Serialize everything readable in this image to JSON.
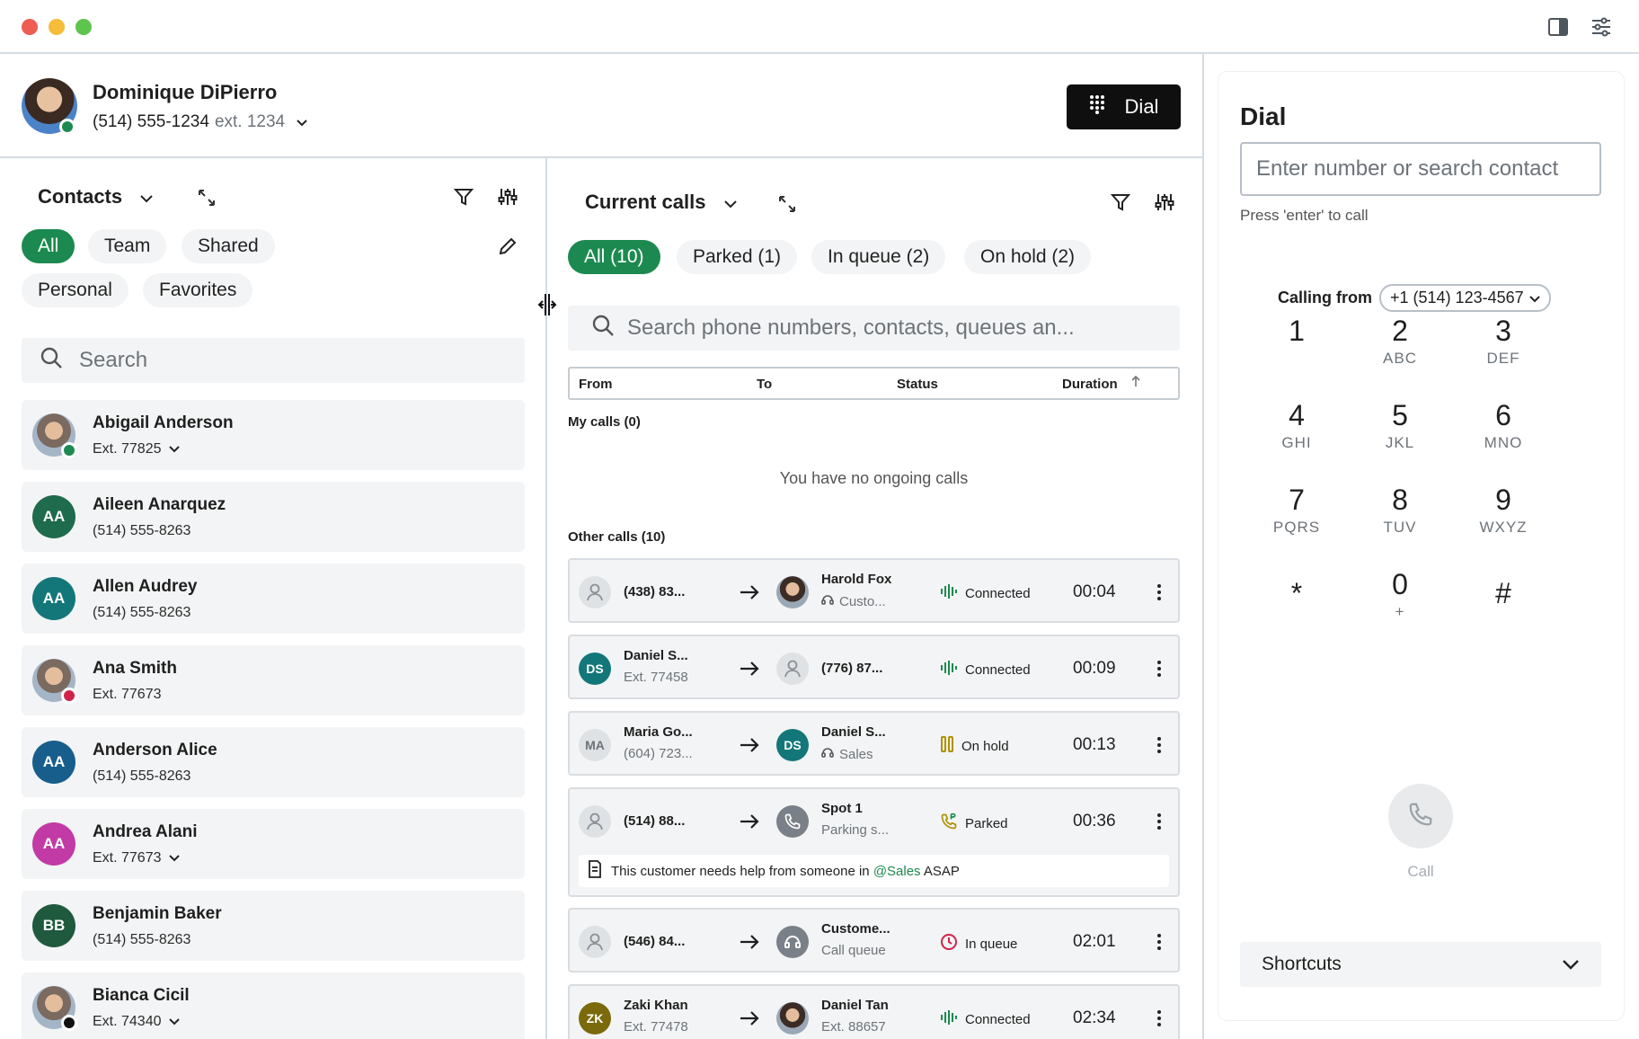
{
  "user": {
    "name": "Dominique DiPierro",
    "phone": "(514) 555-1234",
    "ext": "ext. 1234",
    "presence_color": "#1c8a50"
  },
  "dial_button": "Dial",
  "contacts": {
    "title": "Contacts",
    "filters": [
      "All",
      "Team",
      "Shared",
      "Personal",
      "Favorites"
    ],
    "search_placeholder": "Search",
    "items": [
      {
        "name": "Abigail Anderson",
        "sub": "Ext. 77825",
        "initials": "",
        "color": "",
        "presence": "available",
        "has_chevron": true
      },
      {
        "name": "Aileen Anarquez",
        "sub": "(514) 555-8263",
        "initials": "AA",
        "color": "#1f6b4d",
        "presence": "",
        "has_chevron": false
      },
      {
        "name": "Allen Audrey",
        "sub": "(514) 555-8263",
        "initials": "AA",
        "color": "#13777a",
        "presence": "",
        "has_chevron": false
      },
      {
        "name": "Ana Smith",
        "sub": "Ext. 77673",
        "initials": "",
        "color": "",
        "presence": "busy",
        "has_chevron": false
      },
      {
        "name": "Anderson Alice",
        "sub": "(514) 555-8263",
        "initials": "AA",
        "color": "#175e8c",
        "presence": "",
        "has_chevron": false
      },
      {
        "name": "Andrea Alani",
        "sub": "Ext. 77673",
        "initials": "AA",
        "color": "#c13aa6",
        "presence": "",
        "has_chevron": true
      },
      {
        "name": "Benjamin Baker",
        "sub": "(514) 555-8263",
        "initials": "BB",
        "color": "#1f5a3f",
        "presence": "",
        "has_chevron": false
      },
      {
        "name": "Bianca Cicil",
        "sub": "Ext. 74340",
        "initials": "",
        "color": "",
        "presence": "dnd",
        "has_chevron": true
      }
    ]
  },
  "calls": {
    "title": "Current calls",
    "filters": [
      "All (10)",
      "Parked (1)",
      "In queue (2)",
      "On hold (2)"
    ],
    "search_placeholder": "Search phone numbers, contacts, queues an...",
    "columns": [
      "From",
      "To",
      "Status",
      "Duration"
    ],
    "my_calls_label": "My calls (0)",
    "empty_message": "You have no ongoing calls",
    "other_calls_label": "Other calls (10)",
    "items": [
      {
        "from": "(438) 83...",
        "from_sub": "",
        "from_initials": "",
        "from_color": "",
        "to": "Harold Fox",
        "to_sub": "Custo...",
        "to_type": "photo",
        "to_initials": "",
        "to_color": "",
        "status": "Connected",
        "status_type": "connected",
        "duration": "00:04"
      },
      {
        "from": "Daniel S...",
        "from_sub": "Ext. 77458",
        "from_initials": "DS",
        "from_color": "#13777a",
        "to": "(776) 87...",
        "to_sub": "",
        "to_type": "generic",
        "to_initials": "",
        "to_color": "",
        "status": "Connected",
        "status_type": "connected",
        "duration": "00:09"
      },
      {
        "from": "Maria Go...",
        "from_sub": "(604) 723...",
        "from_initials": "MA",
        "from_color": "#dfe2e5",
        "to": "Daniel S...",
        "to_sub": "Sales",
        "to_type": "initials",
        "to_initials": "DS",
        "to_color": "#13777a",
        "status": "On hold",
        "status_type": "hold",
        "duration": "00:13"
      },
      {
        "from": "(514) 88...",
        "from_sub": "",
        "from_initials": "",
        "from_color": "",
        "to": "Spot 1",
        "to_sub": "Parking s...",
        "to_type": "parking",
        "to_initials": "",
        "to_color": "",
        "status": "Parked",
        "status_type": "parked",
        "duration": "00:36",
        "note_prefix": "This customer needs help from someone in",
        "note_mention": "@Sales",
        "note_suffix": "ASAP"
      },
      {
        "from": "(546) 84...",
        "from_sub": "",
        "from_initials": "",
        "from_color": "",
        "to": "Custome...",
        "to_sub": "Call queue",
        "to_type": "queue",
        "to_initials": "",
        "to_color": "",
        "status": "In queue",
        "status_type": "queue",
        "duration": "02:01"
      },
      {
        "from": "Zaki Khan",
        "from_sub": "Ext. 77478",
        "from_initials": "ZK",
        "from_color": "#7a6a0c",
        "to": "Daniel Tan",
        "to_sub": "Ext. 88657",
        "to_type": "photo",
        "to_initials": "",
        "to_color": "",
        "status": "Connected",
        "status_type": "connected",
        "duration": "02:34"
      }
    ]
  },
  "dial": {
    "title": "Dial",
    "input_placeholder": "Enter number or search contact",
    "hint": "Press 'enter' to call",
    "calling_from_label": "Calling from",
    "calling_from_value": "+1 (514) 123-4567",
    "keys": [
      {
        "digit": "1",
        "letters": ""
      },
      {
        "digit": "2",
        "letters": "ABC"
      },
      {
        "digit": "3",
        "letters": "DEF"
      },
      {
        "digit": "4",
        "letters": "GHI"
      },
      {
        "digit": "5",
        "letters": "JKL"
      },
      {
        "digit": "6",
        "letters": "MNO"
      },
      {
        "digit": "7",
        "letters": "PQRS"
      },
      {
        "digit": "8",
        "letters": "TUV"
      },
      {
        "digit": "9",
        "letters": "WXYZ"
      },
      {
        "digit": "*",
        "letters": ""
      },
      {
        "digit": "0",
        "letters": "+"
      },
      {
        "digit": "#",
        "letters": ""
      }
    ],
    "call_label": "Call",
    "shortcuts_label": "Shortcuts"
  },
  "colors": {
    "accent": "#1c8a50",
    "busy": "#d1234a",
    "hold": "#a88a00",
    "queue": "#d1234a"
  }
}
